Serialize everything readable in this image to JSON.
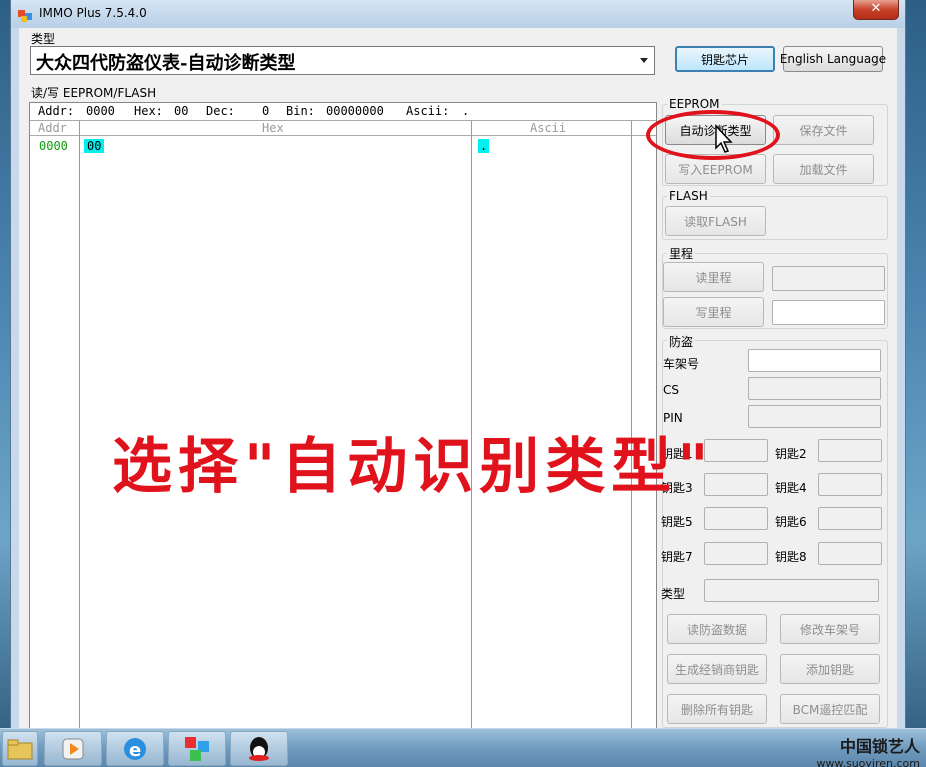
{
  "window": {
    "title": "IMMO Plus 7.5.4.0",
    "close_glyph": "✕"
  },
  "type_label": "类型",
  "type_value": "大众四代防盗仪表-自动诊断类型",
  "buttons_top": {
    "key_chip": "钥匙芯片",
    "english": "English Language"
  },
  "rw_label": "读/写 EEPROM/FLASH",
  "grid_top": {
    "addr_label": "Addr:",
    "addr": "0000",
    "hex_label": "Hex:",
    "hex": "00",
    "dec_label": "Dec:",
    "dec": "0",
    "bin_label": "Bin:",
    "bin": "00000000",
    "ascii_label": "Ascii:",
    "ascii": "."
  },
  "grid_head": {
    "addr": "Addr",
    "hex": "Hex",
    "ascii": "Ascii"
  },
  "grid_row": {
    "addr": "0000",
    "hex": "00",
    "ascii": "."
  },
  "eeprom": {
    "label": "EEPROM",
    "auto": "自动诊断类型",
    "save": "保存文件",
    "write": "写入EEPROM",
    "load": "加载文件"
  },
  "flash": {
    "label": "FLASH",
    "read": "读取FLASH"
  },
  "mileage": {
    "label": "里程",
    "read": "读里程",
    "write": "写里程"
  },
  "immo": {
    "label": "防盗",
    "vin": "车架号",
    "cs": "CS",
    "pin": "PIN",
    "keys": [
      "钥匙1",
      "钥匙2",
      "钥匙3",
      "钥匙4",
      "钥匙5",
      "钥匙6",
      "钥匙7",
      "钥匙8"
    ],
    "type": "类型",
    "read_data": "读防盗数据",
    "modify_vin": "修改车架号",
    "gen_dealer_key": "生成经销商钥匙",
    "add_key": "添加钥匙",
    "del_all_keys": "删除所有钥匙",
    "bcm": "BCM遥控匹配"
  },
  "overlay_text": "选择\"自动识别类型\"",
  "watermark": {
    "brand": "中国锁艺人",
    "url": "www.suoyiren.com"
  },
  "colors": {
    "accent_red": "#e0121b",
    "addr_green": "#119a11",
    "sel_cyan": "#00f0f0"
  }
}
